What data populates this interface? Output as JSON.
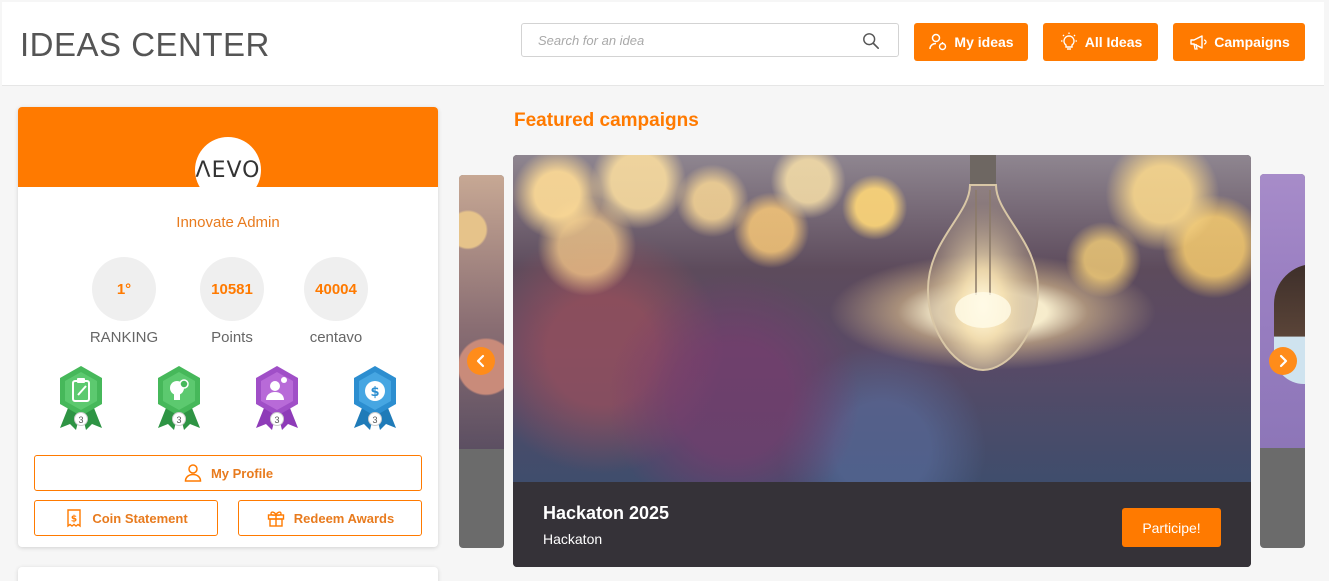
{
  "header": {
    "title": "IDEAS CENTER",
    "search_placeholder": "Search for an idea",
    "buttons": {
      "my_ideas": "My ideas",
      "all_ideas": "All Ideas",
      "campaigns": "Campaigns"
    }
  },
  "profile": {
    "logo_text": "ΛEVO",
    "name": "Innovate Admin",
    "stats": [
      {
        "value": "1°",
        "label": "RANKING"
      },
      {
        "value": "10581",
        "label": "Points"
      },
      {
        "value": "40004",
        "label": "centavo"
      }
    ],
    "badges": [
      {
        "icon": "clipboard-icon",
        "count": "3",
        "color": "#3fae53"
      },
      {
        "icon": "lightbulb-icon",
        "count": "3",
        "color": "#3fae53"
      },
      {
        "icon": "user-gear-icon",
        "count": "3",
        "color": "#a04fc7"
      },
      {
        "icon": "dollar-icon",
        "count": "3",
        "color": "#2c8ed0"
      }
    ],
    "actions": {
      "my_profile": "My Profile",
      "coin_statement": "Coin Statement",
      "redeem_awards": "Redeem Awards"
    }
  },
  "featured": {
    "title": "Featured campaigns",
    "current": {
      "name": "Hackaton 2025",
      "type": "Hackaton",
      "button": "Participe!"
    }
  },
  "colors": {
    "accent": "#ff7a00",
    "caption_bg": "#353238"
  }
}
